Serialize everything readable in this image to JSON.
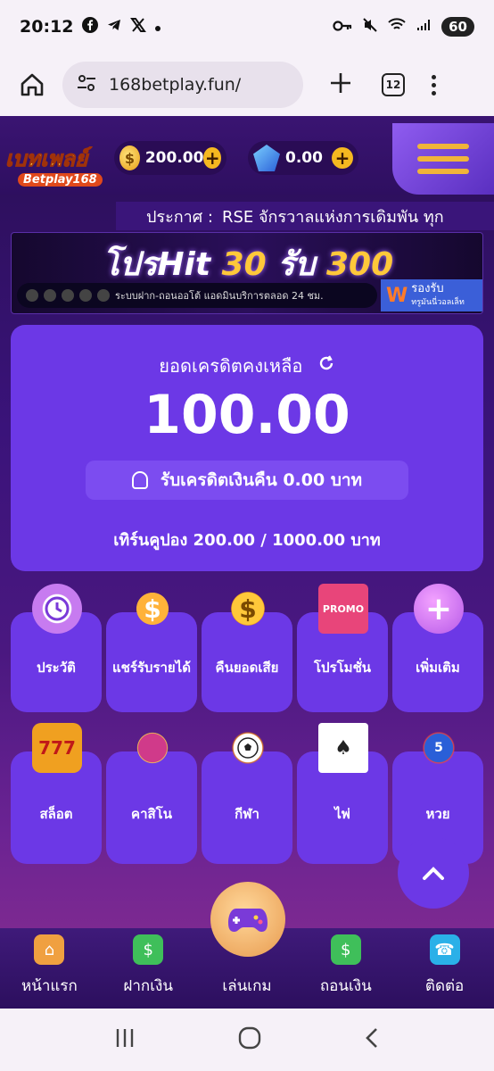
{
  "status_bar": {
    "time": "20:12",
    "battery": "60"
  },
  "browser": {
    "url": "168betplay.fun/",
    "tab_count": "12"
  },
  "header": {
    "logo_text": "เบทเพลย์",
    "logo_sub": "Betplay168",
    "coin_balance": "200.00",
    "gem_balance": "0.00"
  },
  "marquee": {
    "label": "ประกาศ :",
    "text": "RSE จักรวาลแห่งการเดิมพัน ทุก"
  },
  "banner": {
    "title_a": "โปรHit",
    "title_b": "30",
    "title_c": "รับ",
    "title_d": "300",
    "strip_text": "ระบบฝาก-ถอนออโต้ แอดมินบริการตลอด 24 ชม.",
    "support_title": "รองรับ",
    "support_sub": "ทรูมันนี่วอลเล็ท"
  },
  "credit": {
    "title": "ยอดเครดิตคงเหลือ",
    "amount": "100.00",
    "cashback": "รับเครดิตเงินคืน  0.00  บาท",
    "turnover": "เทิร์นคูปอง 200.00 / 1000.00 บาท"
  },
  "menu_row1": [
    {
      "label": "ประวัติ",
      "icon": "clock-icon"
    },
    {
      "label": "แชร์รับรายได้",
      "icon": "share-icon"
    },
    {
      "label": "คืนยอดเสีย",
      "icon": "cashback-icon"
    },
    {
      "label": "โปรโมชั่น",
      "icon": "promo-gift-icon"
    },
    {
      "label": "เพิ่มเติม",
      "icon": "plus-icon"
    }
  ],
  "menu_row2": [
    {
      "label": "สล็อต",
      "icon": "slot-icon"
    },
    {
      "label": "คาสิโน",
      "icon": "casino-icon"
    },
    {
      "label": "กีฬา",
      "icon": "sports-icon"
    },
    {
      "label": "ไพ่",
      "icon": "cards-icon"
    },
    {
      "label": "หวย",
      "icon": "lottery-icon"
    }
  ],
  "bottom_nav": [
    {
      "label": "หน้าแรก",
      "icon": "house-icon"
    },
    {
      "label": "ฝากเงิน",
      "icon": "deposit-icon"
    },
    {
      "label": "เล่นเกม",
      "icon": "gamepad-icon"
    },
    {
      "label": "ถอนเงิน",
      "icon": "withdraw-icon"
    },
    {
      "label": "ติดต่อ",
      "icon": "contact-icon"
    }
  ],
  "colors": {
    "card": "#6c38e6",
    "accent_gold": "#f5b820",
    "page_bg": "#2a0f55"
  }
}
